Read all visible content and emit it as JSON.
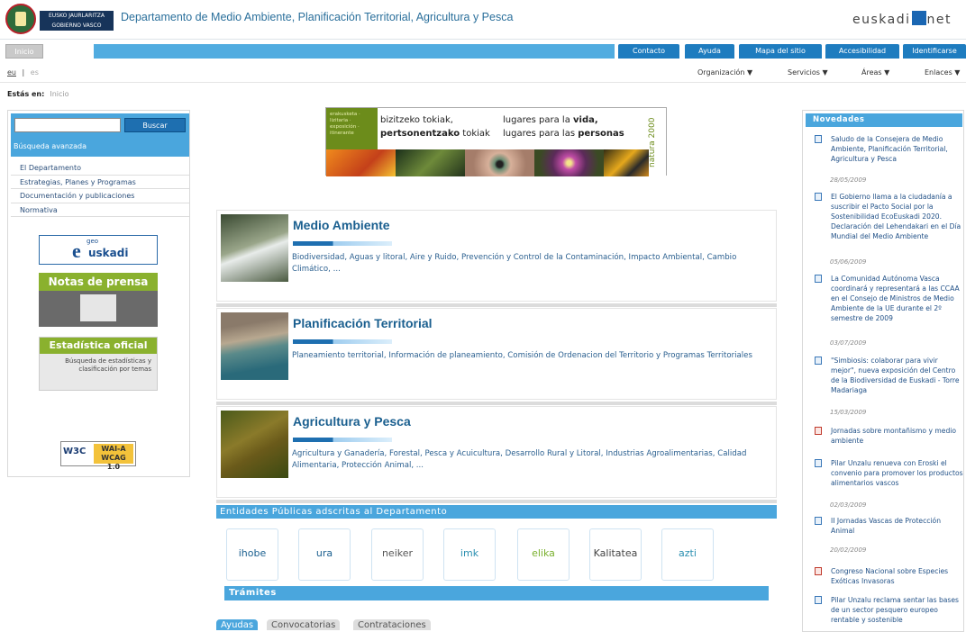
{
  "header": {
    "gov_name_line1": "EUSKO JAURLARITZA",
    "gov_name_line2": "GOBIERNO VASCO",
    "dept_title": "Departamento de Medio Ambiente, Planificación Territorial, Agricultura y Pesca",
    "portal_left": "euskadi",
    "portal_right": "net"
  },
  "nav": {
    "inicio": "Inicio",
    "buttons": [
      "Contacto",
      "Ayuda",
      "Mapa del sitio",
      "Accesibilidad",
      "Identificarse"
    ]
  },
  "subnav": {
    "lang_eu": "eu",
    "lang_sep": "|",
    "lang_es": "es",
    "items": [
      "Organización",
      "Servicios",
      "Áreas",
      "Enlaces"
    ]
  },
  "breadcrumb": {
    "label": "Estás en:",
    "link": "Inicio"
  },
  "search": {
    "placeholder": "",
    "button": "Buscar",
    "advanced": "Búsqueda avanzada"
  },
  "left_menu": [
    "El Departamento",
    "Estrategias, Planes y Programas",
    "Documentación y publicaciones",
    "Normativa"
  ],
  "banners": {
    "geo_small": "geo",
    "geo_e": "e",
    "geo_word": "uskadi",
    "prensa": "Notas de prensa",
    "estadistica": "Estadística oficial",
    "estadistica_desc": "Búsqueda de estadísticas y clasificación por temas",
    "w3c": "W3C",
    "wai": "WAI-A",
    "wcag": "WCAG 1.0"
  },
  "hero": {
    "left_text": "erakusketa · lizitaria · exposición · itinerante",
    "eu_line1": "bizitzeko tokiak,",
    "eu_line2_bold": "pertsonentzako",
    "eu_line2_rest": "tokiak",
    "es_line1": "lugares para la",
    "es_line1_bold": "vida,",
    "es_line2": "lugares para las",
    "es_line2_bold": "personas",
    "natura": "natura 2000"
  },
  "sections": [
    {
      "title": "Medio Ambiente",
      "desc": "Biodiversidad, Aguas y litoral, Aire y Ruido, Prevención y Control de la Contaminación, Impacto Ambiental, Cambio Climático, ..."
    },
    {
      "title": "Planificación Territorial",
      "desc": "Planeamiento territorial, Información de planeamiento, Comisión de Ordenacion del Territorio y Programas Territoriales"
    },
    {
      "title": "Agricultura y Pesca",
      "desc": "Agricultura y Ganadería, Forestal, Pesca y Acuicultura, Desarrollo Rural y Litoral, Industrias Agroalimentarias, Calidad Alimentaria, Protección Animal, ..."
    }
  ],
  "entities": {
    "title": "Entidades Públicas adscritas al Departamento",
    "items": [
      {
        "name": "ihobe",
        "color": "#1a5f8f"
      },
      {
        "name": "ura",
        "color": "#1a5f8f"
      },
      {
        "name": "neiker",
        "color": "#555"
      },
      {
        "name": "imk",
        "color": "#2a8fb0"
      },
      {
        "name": "elika",
        "color": "#7ab02e"
      },
      {
        "name": "Kalitatea",
        "color": "#444"
      },
      {
        "name": "azti",
        "color": "#2a8fb0"
      }
    ]
  },
  "tramites": {
    "title": "Trámites",
    "tabs": [
      "Ayudas",
      "Convocatorias",
      "Contrataciones"
    ]
  },
  "novedades": {
    "title": "Novedades",
    "items": [
      {
        "text": "Saludo de la Consejera de Medio Ambiente, Planificación Territorial, Agricultura y Pesca",
        "date": "28/05/2009",
        "icon": "page-icon"
      },
      {
        "text": "El Gobierno llama a la ciudadanía a suscribir el Pacto Social por la Sostenibilidad EcoEuskadi 2020. Declaración del Lehendakari en el Día Mundial del Medio Ambiente",
        "date": "05/06/2009",
        "icon": "page-icon"
      },
      {
        "text": "La Comunidad Autónoma Vasca coordinará y representará a las CCAA en el Consejo de Ministros de Medio Ambiente de la UE durante el 2º semestre de 2009",
        "date": "03/07/2009",
        "icon": "page-icon"
      },
      {
        "text": "\"Simbiosis: colaborar para vivir mejor\", nueva exposición del Centro de la Biodiversidad de Euskadi - Torre Madariaga",
        "date": "15/03/2009",
        "icon": "page-icon"
      },
      {
        "text": "Jornadas sobre montañismo y medio ambiente",
        "date": "",
        "icon": "pdf-icon"
      },
      {
        "text": "Pilar Unzalu renueva con Eroski el convenio para promover los productos alimentarios vascos",
        "date": "02/03/2009",
        "icon": "page-icon"
      },
      {
        "text": "II Jornadas Vascas de Protección Animal",
        "date": "20/02/2009",
        "icon": "page-icon"
      },
      {
        "text": "Congreso Nacional sobre Especies Exóticas Invasoras",
        "date": "",
        "icon": "pdf-icon"
      },
      {
        "text": "Pilar Unzalu reclama sentar las bases de un sector pesquero europeo rentable y sostenible",
        "date": "",
        "icon": "page-icon"
      }
    ]
  }
}
